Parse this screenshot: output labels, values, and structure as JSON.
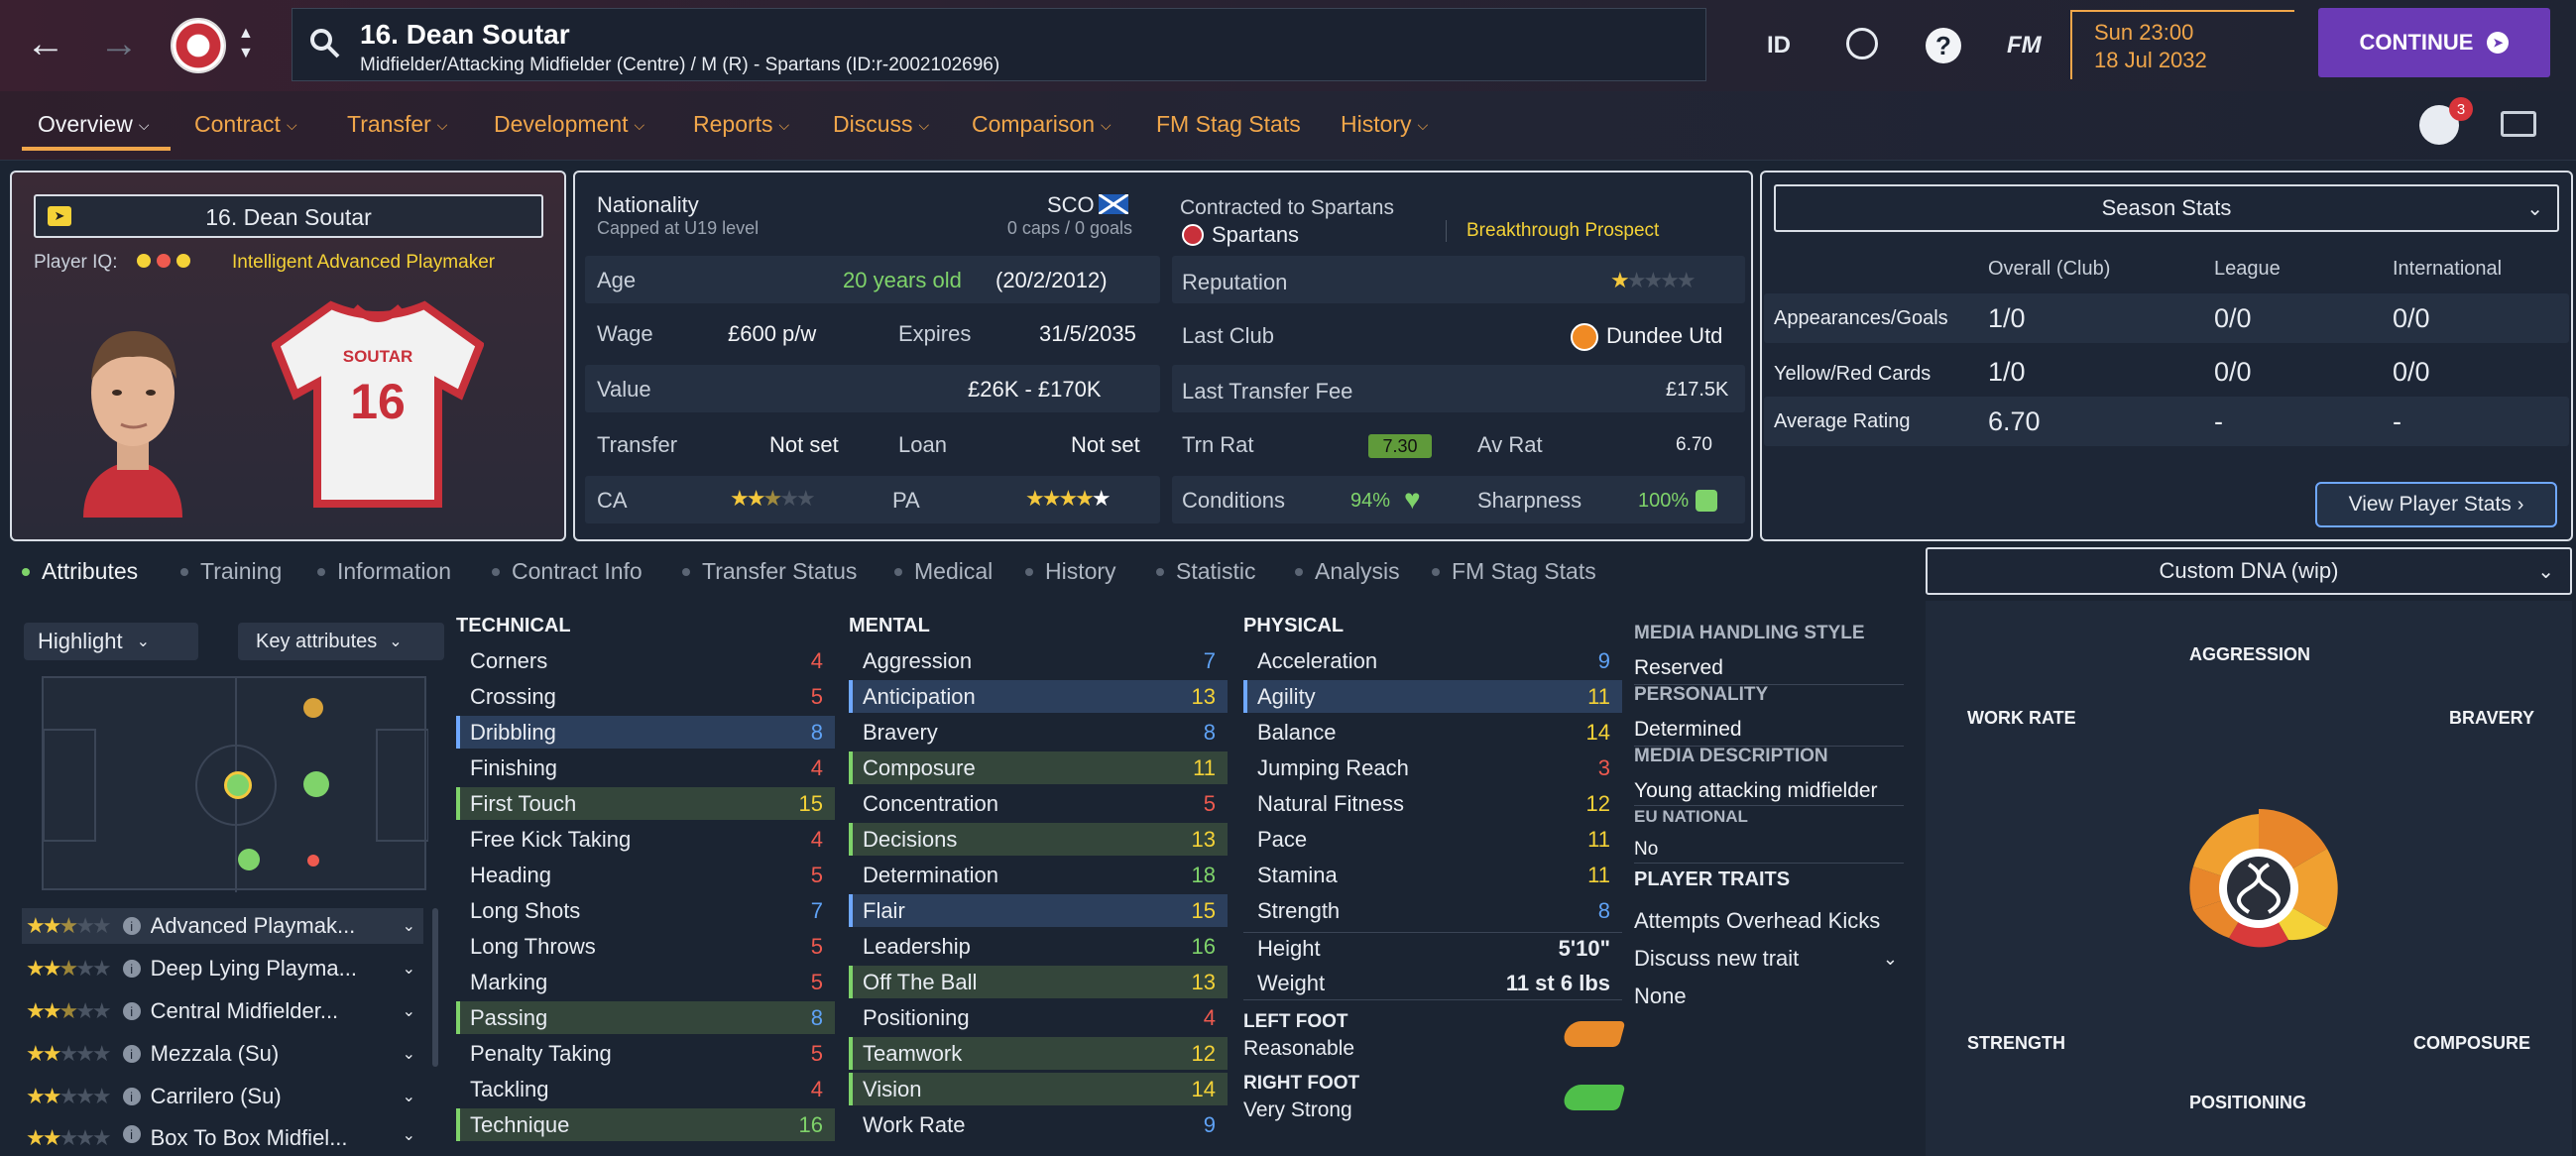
{
  "header": {
    "player_title": "16. Dean Soutar",
    "player_subtitle": "Midfielder/Attacking Midfielder (Centre) / M (R) - Spartans (ID:r-2002102696)",
    "id_label": "ID",
    "fm_label": "FM",
    "date_time": "Sun 23:00",
    "date": "18 Jul 2032",
    "continue_label": "CONTINUE",
    "notification_count": "3"
  },
  "nav": {
    "items": [
      {
        "label": "Overview"
      },
      {
        "label": "Contract"
      },
      {
        "label": "Transfer"
      },
      {
        "label": "Development"
      },
      {
        "label": "Reports"
      },
      {
        "label": "Discuss"
      },
      {
        "label": "Comparison"
      },
      {
        "label": "FM Stag Stats"
      },
      {
        "label": "History"
      }
    ]
  },
  "profile": {
    "name": "16. Dean Soutar",
    "iq_label": "Player IQ:",
    "iq_role": "Intelligent  Advanced Playmaker",
    "shirt_name": "SOUTAR",
    "shirt_number": "16"
  },
  "details": {
    "nationality_label": "Nationality",
    "nationality_code": "SCO",
    "capped": "Capped at U19 level",
    "caps": "0 caps / 0 goals",
    "age_label": "Age",
    "age_value": "20 years old",
    "dob": "(20/2/2012)",
    "wage_label": "Wage",
    "wage_value": "£600 p/w",
    "expires_label": "Expires",
    "expires_value": "31/5/2035",
    "value_label": "Value",
    "value_value": "£26K - £170K",
    "transfer_label": "Transfer",
    "transfer_value": "Not set",
    "loan_label": "Loan",
    "loan_value": "Not set",
    "ca_label": "CA",
    "ca_stars": 2.5,
    "pa_label": "PA",
    "pa_stars": 5,
    "contracted_label": "Contracted to Spartans",
    "club": "Spartans",
    "prospect": "Breakthrough Prospect",
    "reputation_label": "Reputation",
    "reputation_stars": 1,
    "last_club_label": "Last Club",
    "last_club_value": "Dundee Utd",
    "last_fee_label": "Last Transfer Fee",
    "last_fee_value": "£17.5K",
    "trn_rat_label": "Trn Rat",
    "trn_rat_value": "7.30",
    "av_rat_label": "Av Rat",
    "av_rat_value": "6.70",
    "conditions_label": "Conditions",
    "conditions_value": "94%",
    "sharpness_label": "Sharpness",
    "sharpness_value": "100%"
  },
  "season": {
    "selector": "Season Stats",
    "headers": [
      "Overall (Club)",
      "League",
      "International"
    ],
    "rows": [
      {
        "label": "Appearances/Goals",
        "values": [
          "1/0",
          "0/0",
          "0/0"
        ]
      },
      {
        "label": "Yellow/Red Cards",
        "values": [
          "1/0",
          "0/0",
          "0/0"
        ]
      },
      {
        "label": "Average Rating",
        "values": [
          "6.70",
          "-",
          "-"
        ]
      }
    ],
    "view_button": "View Player Stats"
  },
  "tabs": [
    {
      "label": "Attributes"
    },
    {
      "label": "Training"
    },
    {
      "label": "Information"
    },
    {
      "label": "Contract Info"
    },
    {
      "label": "Transfer Status"
    },
    {
      "label": "Medical"
    },
    {
      "label": "History"
    },
    {
      "label": "Statistic"
    },
    {
      "label": "Analysis"
    },
    {
      "label": "FM Stag Stats"
    }
  ],
  "filters": {
    "highlight": "Highlight",
    "key_attributes": "Key attributes"
  },
  "roles": [
    {
      "label": "Advanced Playmak...",
      "stars": 2.5
    },
    {
      "label": "Deep Lying Playma...",
      "stars": 2.5
    },
    {
      "label": "Central Midfielder...",
      "stars": 2.5
    },
    {
      "label": "Mezzala (Su)",
      "stars": 2
    },
    {
      "label": "Carrilero (Su)",
      "stars": 2
    },
    {
      "label": "Box To Box Midfiel...",
      "stars": 2
    }
  ],
  "technical": {
    "title": "TECHNICAL",
    "rows": [
      {
        "label": "Corners",
        "value": "4"
      },
      {
        "label": "Crossing",
        "value": "5"
      },
      {
        "label": "Dribbling",
        "value": "8"
      },
      {
        "label": "Finishing",
        "value": "4"
      },
      {
        "label": "First Touch",
        "value": "15"
      },
      {
        "label": "Free Kick Taking",
        "value": "4"
      },
      {
        "label": "Heading",
        "value": "5"
      },
      {
        "label": "Long Shots",
        "value": "7"
      },
      {
        "label": "Long Throws",
        "value": "5"
      },
      {
        "label": "Marking",
        "value": "5"
      },
      {
        "label": "Passing",
        "value": "8"
      },
      {
        "label": "Penalty Taking",
        "value": "5"
      },
      {
        "label": "Tackling",
        "value": "4"
      },
      {
        "label": "Technique",
        "value": "16"
      }
    ]
  },
  "mental": {
    "title": "MENTAL",
    "rows": [
      {
        "label": "Aggression",
        "value": "7"
      },
      {
        "label": "Anticipation",
        "value": "13"
      },
      {
        "label": "Bravery",
        "value": "8"
      },
      {
        "label": "Composure",
        "value": "11"
      },
      {
        "label": "Concentration",
        "value": "5"
      },
      {
        "label": "Decisions",
        "value": "13"
      },
      {
        "label": "Determination",
        "value": "18"
      },
      {
        "label": "Flair",
        "value": "15"
      },
      {
        "label": "Leadership",
        "value": "16"
      },
      {
        "label": "Off The Ball",
        "value": "13"
      },
      {
        "label": "Positioning",
        "value": "4"
      },
      {
        "label": "Teamwork",
        "value": "12"
      },
      {
        "label": "Vision",
        "value": "14"
      },
      {
        "label": "Work Rate",
        "value": "9"
      }
    ]
  },
  "physical": {
    "title": "PHYSICAL",
    "rows": [
      {
        "label": "Acceleration",
        "value": "9"
      },
      {
        "label": "Agility",
        "value": "11"
      },
      {
        "label": "Balance",
        "value": "14"
      },
      {
        "label": "Jumping Reach",
        "value": "3"
      },
      {
        "label": "Natural Fitness",
        "value": "12"
      },
      {
        "label": "Pace",
        "value": "11"
      },
      {
        "label": "Stamina",
        "value": "11"
      },
      {
        "label": "Strength",
        "value": "8"
      }
    ],
    "height_label": "Height",
    "height_value": "5'10\"",
    "weight_label": "Weight",
    "weight_value": "11 st 6 lbs",
    "left_foot_label": "LEFT FOOT",
    "left_foot_value": "Reasonable",
    "right_foot_label": "RIGHT FOOT",
    "right_foot_value": "Very Strong"
  },
  "info": {
    "media_style_label": "MEDIA HANDLING STYLE",
    "media_style_value": "Reserved",
    "personality_label": "PERSONALITY",
    "personality_value": "Determined",
    "media_desc_label": "MEDIA DESCRIPTION",
    "media_desc_value": "Young attacking midfielder",
    "eu_label": "EU NATIONAL",
    "eu_value": "No",
    "traits_label": "PLAYER TRAITS",
    "traits": [
      "Attempts Overhead Kicks"
    ],
    "discuss_trait": "Discuss new trait",
    "none_label": "None"
  },
  "dna": {
    "selector": "Custom DNA (wip)",
    "labels": {
      "aggression": "AGGRESSION",
      "work_rate": "WORK RATE",
      "bravery": "BRAVERY",
      "strength": "STRENGTH",
      "composure": "COMPOSURE",
      "positioning": "POSITIONING"
    }
  },
  "colors": {
    "accent_orange": "#f0a64a",
    "continue_purple": "#6a3ab5",
    "attr_red": "#ee5a4f",
    "attr_blue": "#5fa2f5",
    "attr_yellow": "#f4d237",
    "attr_green": "#7fd36a"
  }
}
